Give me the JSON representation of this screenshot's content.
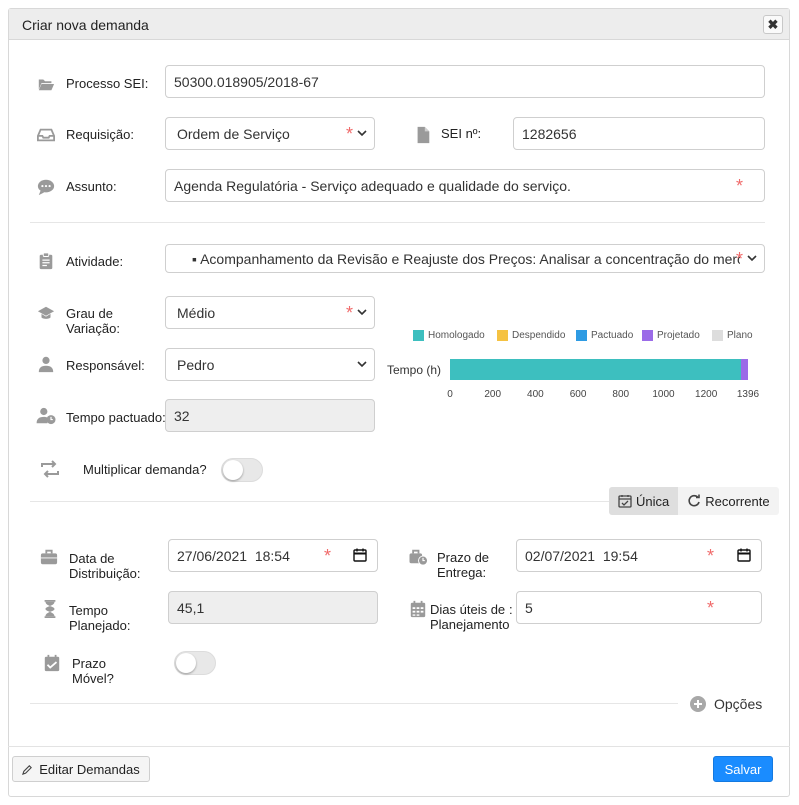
{
  "dialog": {
    "title": "Criar nova demanda",
    "close_glyph": "✖"
  },
  "processo": {
    "label": "Processo SEI:",
    "value": "50300.018905/2018-67",
    "icon": "folder-open-icon"
  },
  "requisicao": {
    "label": "Requisição:",
    "value": "Ordem de Serviço",
    "icon": "inbox-icon"
  },
  "sei_numero": {
    "label": "SEI nº:",
    "value": "1282656",
    "icon": "file-icon"
  },
  "assunto": {
    "label": "Assunto:",
    "value": "Agenda Regulatória - Serviço adequado e qualidade do serviço.",
    "icon": "comment-icon"
  },
  "atividade": {
    "label": "Atividade:",
    "value": "▪ Acompanhamento da Revisão e Reajuste dos Preços: Analisar a concentração do mercado",
    "icon": "clipboard-icon"
  },
  "grau": {
    "label_line1": "Grau de",
    "label_line2": "Variação:",
    "value": "Médio",
    "icon": "graduation-cap-icon"
  },
  "responsavel": {
    "label": "Responsável:",
    "value": "Pedro",
    "icon": "user-icon"
  },
  "tempo_pactuado": {
    "label": "Tempo pactuado:",
    "value": "32",
    "icon": "user-clock-icon"
  },
  "multiplicar": {
    "label": "Multiplicar demanda?",
    "icon": "retweet-icon",
    "enabled": false
  },
  "recorrencia": {
    "options": [
      "Única",
      "Recorrente"
    ],
    "selected": "Única"
  },
  "data_distribuicao": {
    "label_line1": "Data de",
    "label_line2": "Distribuição:",
    "value": "27/06/2021  18:54",
    "icon": "briefcase-icon"
  },
  "prazo_entrega": {
    "label_line1": "Prazo de",
    "label_line2": "Entrega:",
    "value": "02/07/2021  19:54",
    "icon": "briefcase-clock-icon"
  },
  "tempo_planejado": {
    "label_line1": "Tempo",
    "label_line2": "Planejado:",
    "value": "45,1",
    "icon": "hourglass-icon"
  },
  "dias_uteis": {
    "label_line1": "Dias úteis de",
    "label_line2": "Planejamento",
    "colon": ":",
    "value": "5",
    "icon": "calendar-icon"
  },
  "prazo_movel": {
    "label_line1": "Prazo",
    "label_line2": "Móvel?",
    "icon": "calendar-check-icon",
    "enabled": false
  },
  "opcoes": {
    "label": "Opções",
    "icon": "plus-circle-icon"
  },
  "footer": {
    "edit_label": "Editar Demandas",
    "edit_icon": "pencil-icon",
    "save_label": "Salvar"
  },
  "colors": {
    "primary": "#1a8cff",
    "required": "#f06a6a"
  },
  "chart_data": {
    "type": "bar",
    "orientation": "horizontal",
    "categories": [
      "Tempo (h)"
    ],
    "series": [
      {
        "name": "Homologado",
        "color": "#3dbfbf",
        "values": [
          1365
        ]
      },
      {
        "name": "Despendido",
        "color": "#f5c242",
        "values": [
          0
        ]
      },
      {
        "name": "Pactuado",
        "color": "#2e9be3",
        "values": [
          0
        ]
      },
      {
        "name": "Projetado",
        "color": "#9b6be8",
        "values": [
          31
        ]
      },
      {
        "name": "Plano",
        "color": "#dddddd",
        "values": [
          0
        ]
      }
    ],
    "ylabel": "Tempo (h)",
    "xticks": [
      "0",
      "200",
      "400",
      "600",
      "800",
      "1000",
      "1200",
      "1396"
    ],
    "xlim": [
      0,
      1396
    ],
    "stacked": true,
    "legend": "top"
  }
}
